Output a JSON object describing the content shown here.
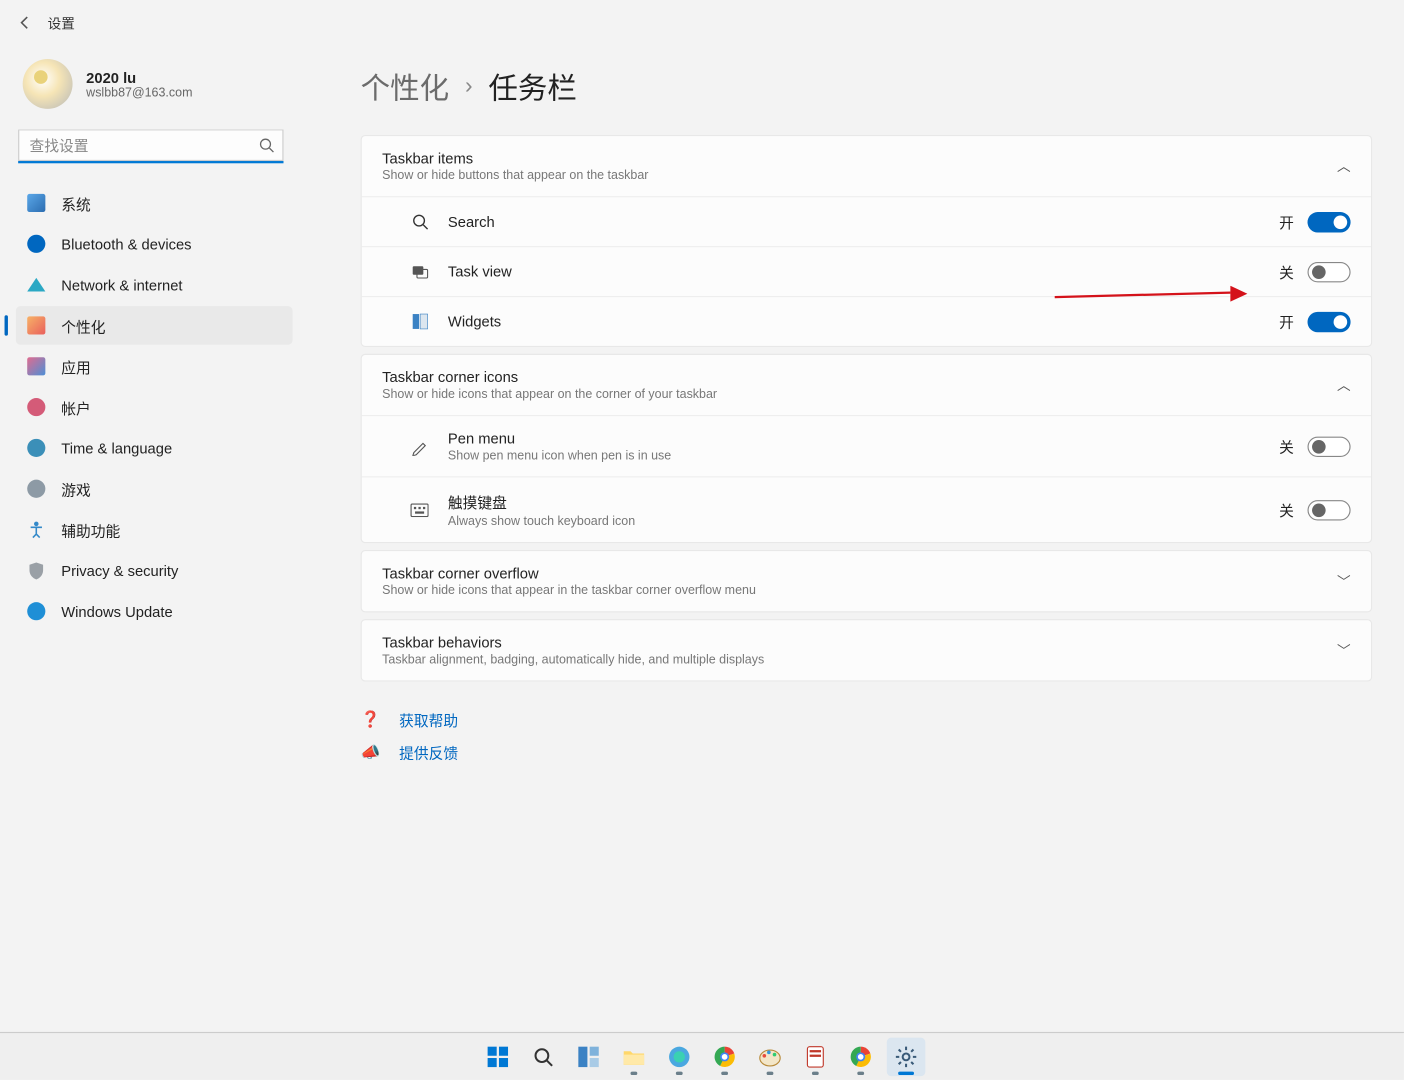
{
  "window": {
    "title": "设置"
  },
  "user": {
    "name": "2020 lu",
    "email": "wslbb87@163.com"
  },
  "search": {
    "placeholder": "查找设置"
  },
  "sidebar": {
    "items": [
      {
        "label": "系统",
        "icon": "system"
      },
      {
        "label": "Bluetooth & devices",
        "icon": "bluetooth"
      },
      {
        "label": "Network & internet",
        "icon": "network"
      },
      {
        "label": "个性化",
        "icon": "personalization",
        "active": true
      },
      {
        "label": "应用",
        "icon": "apps"
      },
      {
        "label": "帐户",
        "icon": "accounts"
      },
      {
        "label": "Time & language",
        "icon": "time"
      },
      {
        "label": "游戏",
        "icon": "gaming"
      },
      {
        "label": "辅助功能",
        "icon": "accessibility"
      },
      {
        "label": "Privacy & security",
        "icon": "privacy"
      },
      {
        "label": "Windows Update",
        "icon": "update"
      }
    ]
  },
  "breadcrumb": {
    "parent": "个性化",
    "current": "任务栏"
  },
  "toggle_labels": {
    "on": "开",
    "off": "关"
  },
  "sections": {
    "taskbar_items": {
      "title": "Taskbar items",
      "subtitle": "Show or hide buttons that appear on the taskbar",
      "expanded": true,
      "rows": [
        {
          "icon": "search",
          "label": "Search",
          "state": "on"
        },
        {
          "icon": "taskview",
          "label": "Task view",
          "state": "off",
          "annotated": true
        },
        {
          "icon": "widgets",
          "label": "Widgets",
          "state": "on"
        }
      ]
    },
    "corner_icons": {
      "title": "Taskbar corner icons",
      "subtitle": "Show or hide icons that appear on the corner of your taskbar",
      "expanded": true,
      "rows": [
        {
          "icon": "pen",
          "label": "Pen menu",
          "sub": "Show pen menu icon when pen is in use",
          "state": "off"
        },
        {
          "icon": "keyboard",
          "label": "触摸键盘",
          "sub": "Always show touch keyboard icon",
          "state": "off"
        }
      ]
    },
    "overflow": {
      "title": "Taskbar corner overflow",
      "subtitle": "Show or hide icons that appear in the taskbar corner overflow menu",
      "expanded": false
    },
    "behaviors": {
      "title": "Taskbar behaviors",
      "subtitle": "Taskbar alignment, badging, automatically hide, and multiple displays",
      "expanded": false
    }
  },
  "help": {
    "get_help": "获取帮助",
    "feedback": "提供反馈"
  },
  "taskbar_pinned": [
    "start",
    "search",
    "taskview",
    "explorer",
    "whiteboard",
    "chrome",
    "paint",
    "notes",
    "chrome2",
    "settings"
  ],
  "colors": {
    "accent": "#0067c0",
    "annotation": "#d4121a"
  }
}
